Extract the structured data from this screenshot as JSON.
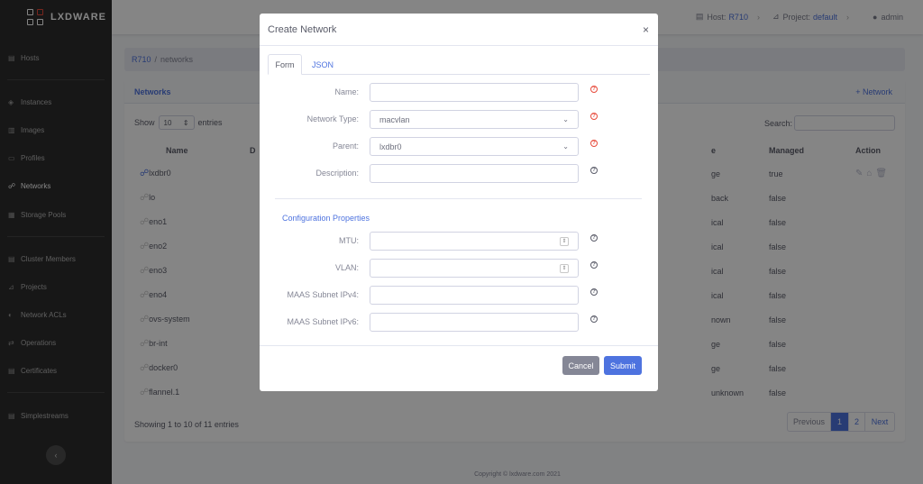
{
  "brand": {
    "name": "LXDWARE"
  },
  "sidebar": {
    "items": [
      {
        "label": "Hosts",
        "icon": "server-icon"
      },
      {
        "label": "Instances",
        "icon": "cube-icon"
      },
      {
        "label": "Images",
        "icon": "layers-icon"
      },
      {
        "label": "Profiles",
        "icon": "id-card-icon"
      },
      {
        "label": "Networks",
        "icon": "network-icon"
      },
      {
        "label": "Storage Pools",
        "icon": "database-icon"
      },
      {
        "label": "Cluster Members",
        "icon": "cluster-icon"
      },
      {
        "label": "Projects",
        "icon": "chart-icon"
      },
      {
        "label": "Network ACLs",
        "icon": "shield-icon"
      },
      {
        "label": "Operations",
        "icon": "exchange-icon"
      },
      {
        "label": "Certificates",
        "icon": "certificate-icon"
      },
      {
        "label": "Simplestreams",
        "icon": "stream-icon"
      }
    ],
    "collapse": "‹"
  },
  "topbar": {
    "host_label": "Host:",
    "host_value": "R710",
    "project_label": "Project:",
    "project_value": "default",
    "user": "admin",
    "chevron": "›"
  },
  "breadcrumb": {
    "host": "R710",
    "sep": "/",
    "current": "networks"
  },
  "card": {
    "title": "Networks",
    "add_label": "+ Network",
    "show_label": "Show",
    "entries_value": "10",
    "entries_label": "entries",
    "search_label": "Search:",
    "columns": [
      "Name",
      "Managed",
      "Action"
    ],
    "col_d": "D",
    "col_type": "e",
    "rows": [
      {
        "name": "lxdbr0",
        "type": "ge",
        "managed": "true"
      },
      {
        "name": "lo",
        "type": "back",
        "managed": "false"
      },
      {
        "name": "eno1",
        "type": "ical",
        "managed": "false"
      },
      {
        "name": "eno2",
        "type": "ical",
        "managed": "false"
      },
      {
        "name": "eno3",
        "type": "ical",
        "managed": "false"
      },
      {
        "name": "eno4",
        "type": "ical",
        "managed": "false"
      },
      {
        "name": "ovs-system",
        "type": "nown",
        "managed": "false"
      },
      {
        "name": "br-int",
        "type": "ge",
        "managed": "false"
      },
      {
        "name": "docker0",
        "type": "ge",
        "managed": "false"
      },
      {
        "name": "flannel.1",
        "type": "unknown",
        "managed": "false"
      }
    ],
    "showing": "Showing 1 to 10 of 11 entries",
    "pager": {
      "prev": "Previous",
      "p1": "1",
      "p2": "2",
      "next": "Next"
    }
  },
  "footer": "Copyright © lxdware.com 2021",
  "modal": {
    "title": "Create Network",
    "close": "×",
    "tabs": [
      "Form",
      "JSON"
    ],
    "fields": {
      "name": {
        "label": "Name:",
        "value": ""
      },
      "network_type": {
        "label": "Network Type:",
        "value": "macvlan"
      },
      "parent": {
        "label": "Parent:",
        "value": "lxdbr0"
      },
      "description": {
        "label": "Description:",
        "value": ""
      },
      "mtu": {
        "label": "MTU:",
        "value": ""
      },
      "vlan": {
        "label": "VLAN:",
        "value": ""
      },
      "maas_ipv4": {
        "label": "MAAS Subnet IPv4:",
        "value": ""
      },
      "maas_ipv6": {
        "label": "MAAS Subnet IPv6:",
        "value": ""
      }
    },
    "section": "Configuration Properties",
    "help": "?",
    "cancel": "Cancel",
    "submit": "Submit"
  },
  "colors": {
    "primary": "#4e73df",
    "sidebar": "#2d2d2d",
    "required": "#e74a3b",
    "secondary": "#858796"
  }
}
